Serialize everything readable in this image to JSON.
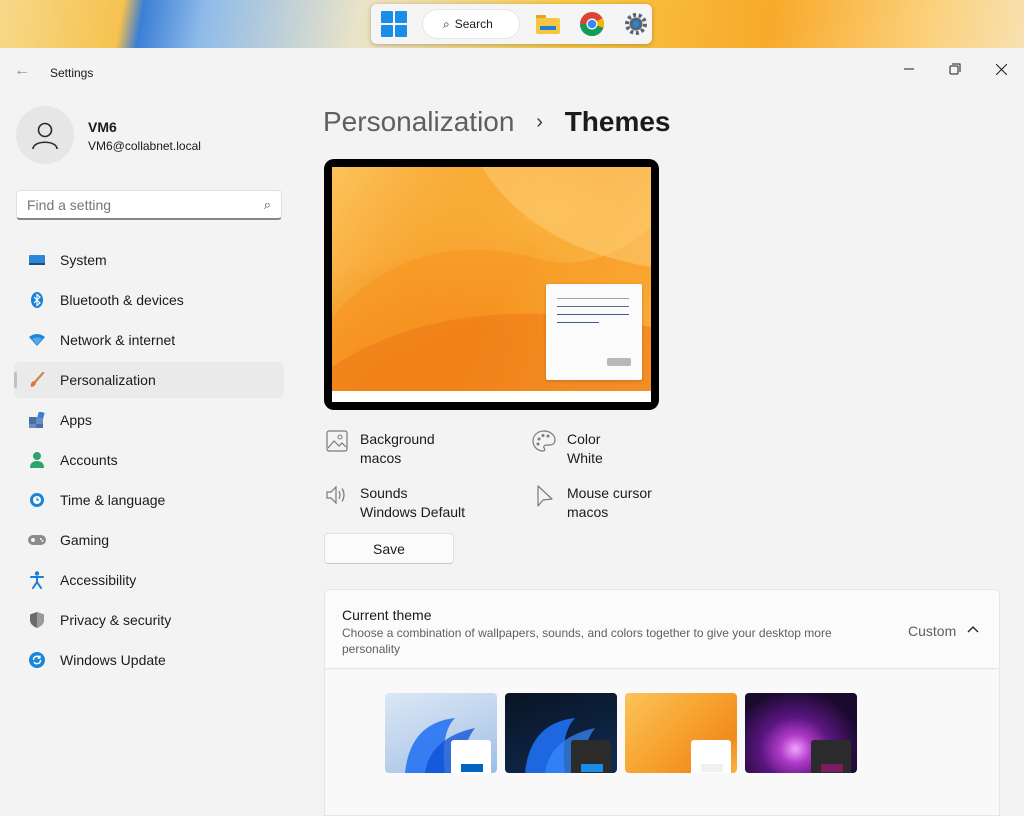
{
  "taskbar": {
    "search_label": "Search",
    "apps": [
      "start-icon",
      "file-explorer-icon",
      "chrome-icon",
      "settings-icon"
    ]
  },
  "window": {
    "title": "Settings",
    "controls": [
      "minimize",
      "maximize",
      "close"
    ]
  },
  "profile": {
    "name": "VM6",
    "email": "VM6@collabnet.local"
  },
  "search": {
    "placeholder": "Find a setting"
  },
  "sidebar": {
    "items": [
      {
        "label": "System",
        "icon": "system-icon",
        "color": "#2b88d8"
      },
      {
        "label": "Bluetooth & devices",
        "icon": "bluetooth-icon",
        "color": "#1a7fd6"
      },
      {
        "label": "Network & internet",
        "icon": "wifi-icon",
        "color": "#1a86d9"
      },
      {
        "label": "Personalization",
        "icon": "brush-icon",
        "color": "#e8703a",
        "active": true
      },
      {
        "label": "Apps",
        "icon": "apps-icon",
        "color": "#4a6fa5"
      },
      {
        "label": "Accounts",
        "icon": "accounts-icon",
        "color": "#2ea36b"
      },
      {
        "label": "Time & language",
        "icon": "globe-clock-icon",
        "color": "#1a86d9"
      },
      {
        "label": "Gaming",
        "icon": "gamepad-icon",
        "color": "#7a7a7a"
      },
      {
        "label": "Accessibility",
        "icon": "accessibility-icon",
        "color": "#1a7fd6"
      },
      {
        "label": "Privacy & security",
        "icon": "shield-icon",
        "color": "#6b6b6b"
      },
      {
        "label": "Windows Update",
        "icon": "update-icon",
        "color": "#1a86d9"
      }
    ]
  },
  "breadcrumb": {
    "parent": "Personalization",
    "separator": "›",
    "current": "Themes"
  },
  "theme_props": {
    "background": {
      "title": "Background",
      "value": "macos"
    },
    "color": {
      "title": "Color",
      "value": "White"
    },
    "sounds": {
      "title": "Sounds",
      "value": "Windows Default"
    },
    "cursor": {
      "title": "Mouse cursor",
      "value": "macos"
    }
  },
  "save_label": "Save",
  "current_theme": {
    "title": "Current theme",
    "description": "Choose a combination of wallpapers, sounds, and colors together to give your desktop more personality",
    "value": "Custom"
  },
  "themes": [
    {
      "name": "windows-light",
      "window_color": "#ffffff",
      "accent": "#0067c0"
    },
    {
      "name": "windows-dark",
      "window_color": "#2b2b2b",
      "accent": "#1a8ee6"
    },
    {
      "name": "macos",
      "window_color": "#ffffff",
      "accent": "#f0f0f0"
    },
    {
      "name": "glow",
      "window_color": "#2b2b2b",
      "accent": "#7a1d5c"
    }
  ],
  "colors": {
    "accent": "#0067c0",
    "window_bg": "#f3f3f3"
  }
}
